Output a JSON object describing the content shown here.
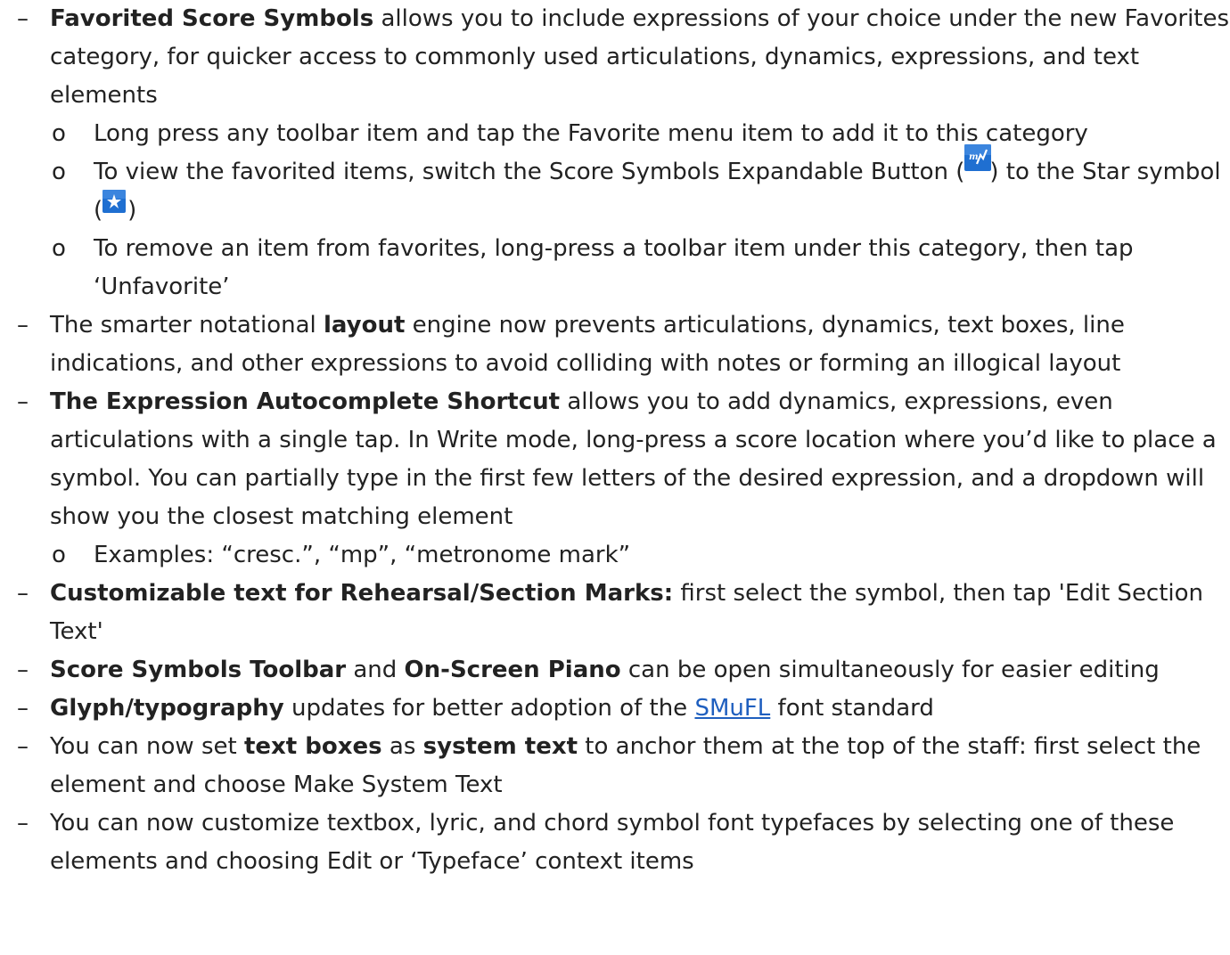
{
  "bullets": {
    "dash": "–",
    "circle": "o"
  },
  "items": {
    "favorites": {
      "bold": "Favorited Score Symbols",
      "text": " allows you to include expressions of your choice under the new Favorites category, for quicker access to commonly used articulations, dynamics, expressions, and text elements",
      "sub1": "Long press any toolbar item and tap the Favorite menu item to add it to this category",
      "sub2_a": "To view the favorited items, switch the Score Symbols Expandable Button (",
      "sub2_b": ") to the Star symbol (",
      "sub2_c": ")",
      "sub3": "To remove an item from favorites, long-press a toolbar item under this category, then tap ‘Unfavorite’"
    },
    "layout": {
      "pre": "The smarter notational ",
      "bold": "layout",
      "post": " engine now prevents articulations, dynamics, text boxes, line indications, and other expressions to avoid colliding with notes or forming an illogical layout"
    },
    "autocomplete": {
      "bold": "The Expression Autocomplete Shortcut",
      "text": " allows you to add dynamics, expressions, even articulations with a single tap. In Write mode, long-press a score location where you’d like to place a symbol. You can partially type in the first few letters of the desired expression, and a dropdown will show you the closest matching element",
      "sub1": "Examples: “cresc.”, “mp”, “metronome mark”"
    },
    "rehearsal": {
      "bold": "Customizable text for Rehearsal/Section Marks:",
      "text": " first select the symbol, then tap 'Edit Section Text'"
    },
    "toolbar": {
      "bold1": "Score Symbols Toolbar",
      "mid": " and ",
      "bold2": "On-Screen Piano",
      "text": " can be open simultaneously for easier editing"
    },
    "glyph": {
      "bold": "Glyph/typography",
      "pre": " updates for better adoption of the ",
      "link": "SMuFL",
      "post": " font standard"
    },
    "systemtext": {
      "pre": "You can now set ",
      "bold1": "text boxes",
      "mid": " as ",
      "bold2": "system text",
      "post": " to anchor them at the top of the staff: first select the element and choose Make System Text"
    },
    "typeface": {
      "text": "You can now customize textbox, lyric, and chord symbol font typefaces by selecting one of these elements and choosing Edit or ‘Typeface’ context items"
    }
  },
  "icons": {
    "expandable_button": "score-symbols-expandable-icon",
    "star_symbol": "star-symbol-icon",
    "icon_bg": "#1f6fd1"
  }
}
